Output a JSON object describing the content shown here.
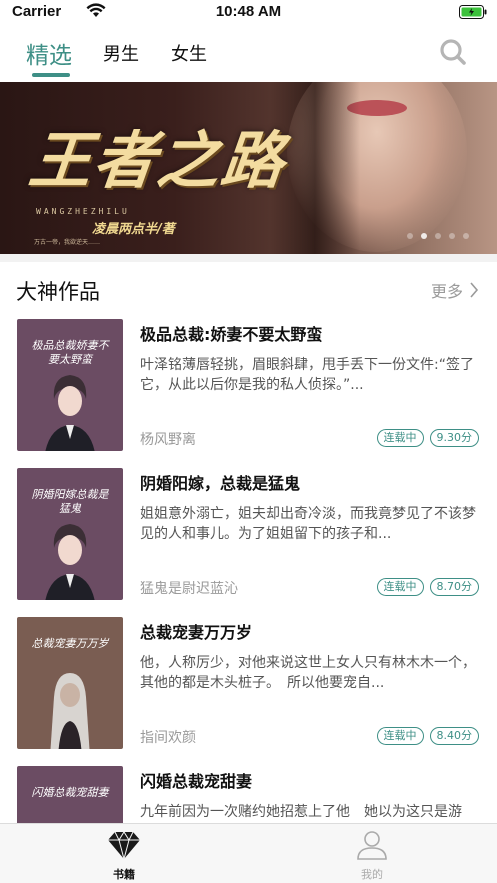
{
  "status_bar": {
    "carrier": "Carrier",
    "time": "10:48 AM"
  },
  "top_tabs": [
    {
      "label": "精选",
      "active": true
    },
    {
      "label": "男生",
      "active": false
    },
    {
      "label": "女生",
      "active": false
    }
  ],
  "accent_color": "#3e8f86",
  "banner": {
    "title": "王者之路",
    "subtitle_latin": "WANGZHEZHILU",
    "author": "凌晨两点半/著",
    "tag": "万古一帝，我欲逆天……",
    "page_count": 5,
    "current_page": 1
  },
  "section": {
    "title": "大神作品",
    "more_label": "更多"
  },
  "books": [
    {
      "title": "极品总裁:娇妻不要太野蛮",
      "cover_title": "极品总裁娇妻不要太野蛮",
      "cover_color": "#6b4c63",
      "desc": "叶泽铭薄唇轻挑，眉眼斜肆，甩手丢下一份文件:“签了它，从此以后你是我的私人侦探。”...",
      "author": "杨风野离",
      "status": "连载中",
      "score": "9.30分"
    },
    {
      "title": "阴婚阳嫁，总裁是猛鬼",
      "cover_title": "阴婚阳嫁总裁是猛鬼",
      "cover_color": "#6b4c63",
      "desc": "姐姐意外溺亡，姐夫却出奇冷淡，而我竟梦见了不该梦见的人和事儿。为了姐姐留下的孩子和...",
      "author": "猛鬼是尉迟蓝沁",
      "status": "连载中",
      "score": "8.70分"
    },
    {
      "title": "总裁宠妻万万岁",
      "cover_title": "总裁宠妻万万岁",
      "cover_color": "#7a5d52",
      "desc": "他，人称厉少，对他来说这世上女人只有林木木一个，其他的都是木头桩子。　所以他要宠自...",
      "author": "指间欢颜",
      "status": "连载中",
      "score": "8.40分"
    },
    {
      "title": "闪婚总裁宠甜妻",
      "cover_title": "闪婚总裁宠甜妻",
      "cover_color": "#6b4c63",
      "desc": "九年前因为一次赌约她招惹上了他　她以为这只是游戏，没想到自己越陷越深，可明便如此她...",
      "author": "",
      "status": "",
      "score": ""
    }
  ],
  "bottom_tabs": [
    {
      "label": "书籍",
      "icon": "diamond-icon",
      "active": true
    },
    {
      "label": "我的",
      "icon": "person-icon",
      "active": false
    }
  ]
}
